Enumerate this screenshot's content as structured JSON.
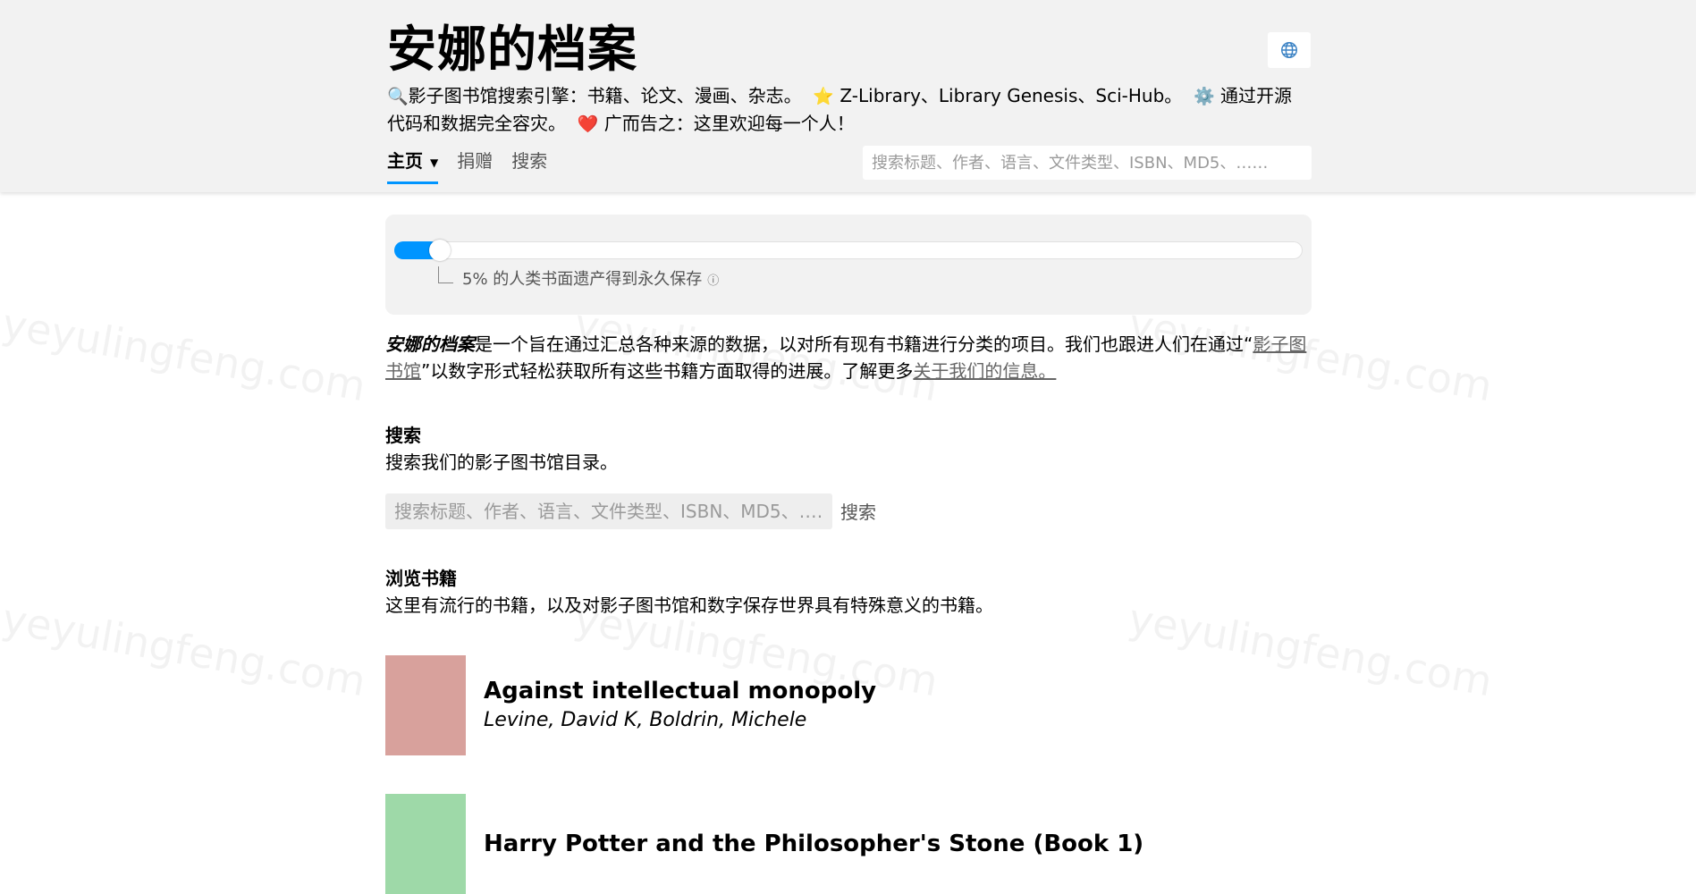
{
  "header": {
    "title": "安娜的档案",
    "tagline_search": "影子图书馆搜索引擎：书籍、论文、漫画、杂志。",
    "tagline_sources": "Z-Library、Library Genesis、Sci-Hub。",
    "tagline_opensource": "通过开源代码和数据完全容灾。",
    "tagline_ad": "广而告之：这里欢迎每一个人！",
    "search_placeholder": "搜索标题、作者、语言、文件类型、ISBN、MD5、……",
    "lang_icon": "globe-icon"
  },
  "nav": {
    "home": "主页",
    "donate": "捐赠",
    "search": "搜索"
  },
  "progress": {
    "percent": 5,
    "label": "5% 的人类书面遗产得到永久保存",
    "info": "ⓘ",
    "fill_color": "#0095ff"
  },
  "intro": {
    "brand": "安娜的档案",
    "part1": "是一个旨在通过汇总各种来源的数据，以对所有现有书籍进行分类的项目。我们也跟进人们在通过“",
    "link1": "影子图书馆",
    "part2": "”以数字形式轻松获取所有这些书籍方面取得的进展。了解更多",
    "link2": "关于我们的信息。"
  },
  "search_section": {
    "title": "搜索",
    "description": "搜索我们的影子图书馆目录。",
    "placeholder": "搜索标题、作者、语言、文件类型、ISBN、MD5、……",
    "button": "搜索"
  },
  "browse_section": {
    "title": "浏览书籍",
    "description": "这里有流行的书籍，以及对影子图书馆和数字保存世界具有特殊意义的书籍。"
  },
  "books": [
    {
      "title": "Against intellectual monopoly",
      "author": "Levine, David K, Boldrin, Michele",
      "cover_color": "#d8a19c"
    },
    {
      "title": "Harry Potter and the Philosopher's Stone (Book 1)",
      "author": "",
      "cover_color": "#9ed9a8"
    }
  ]
}
